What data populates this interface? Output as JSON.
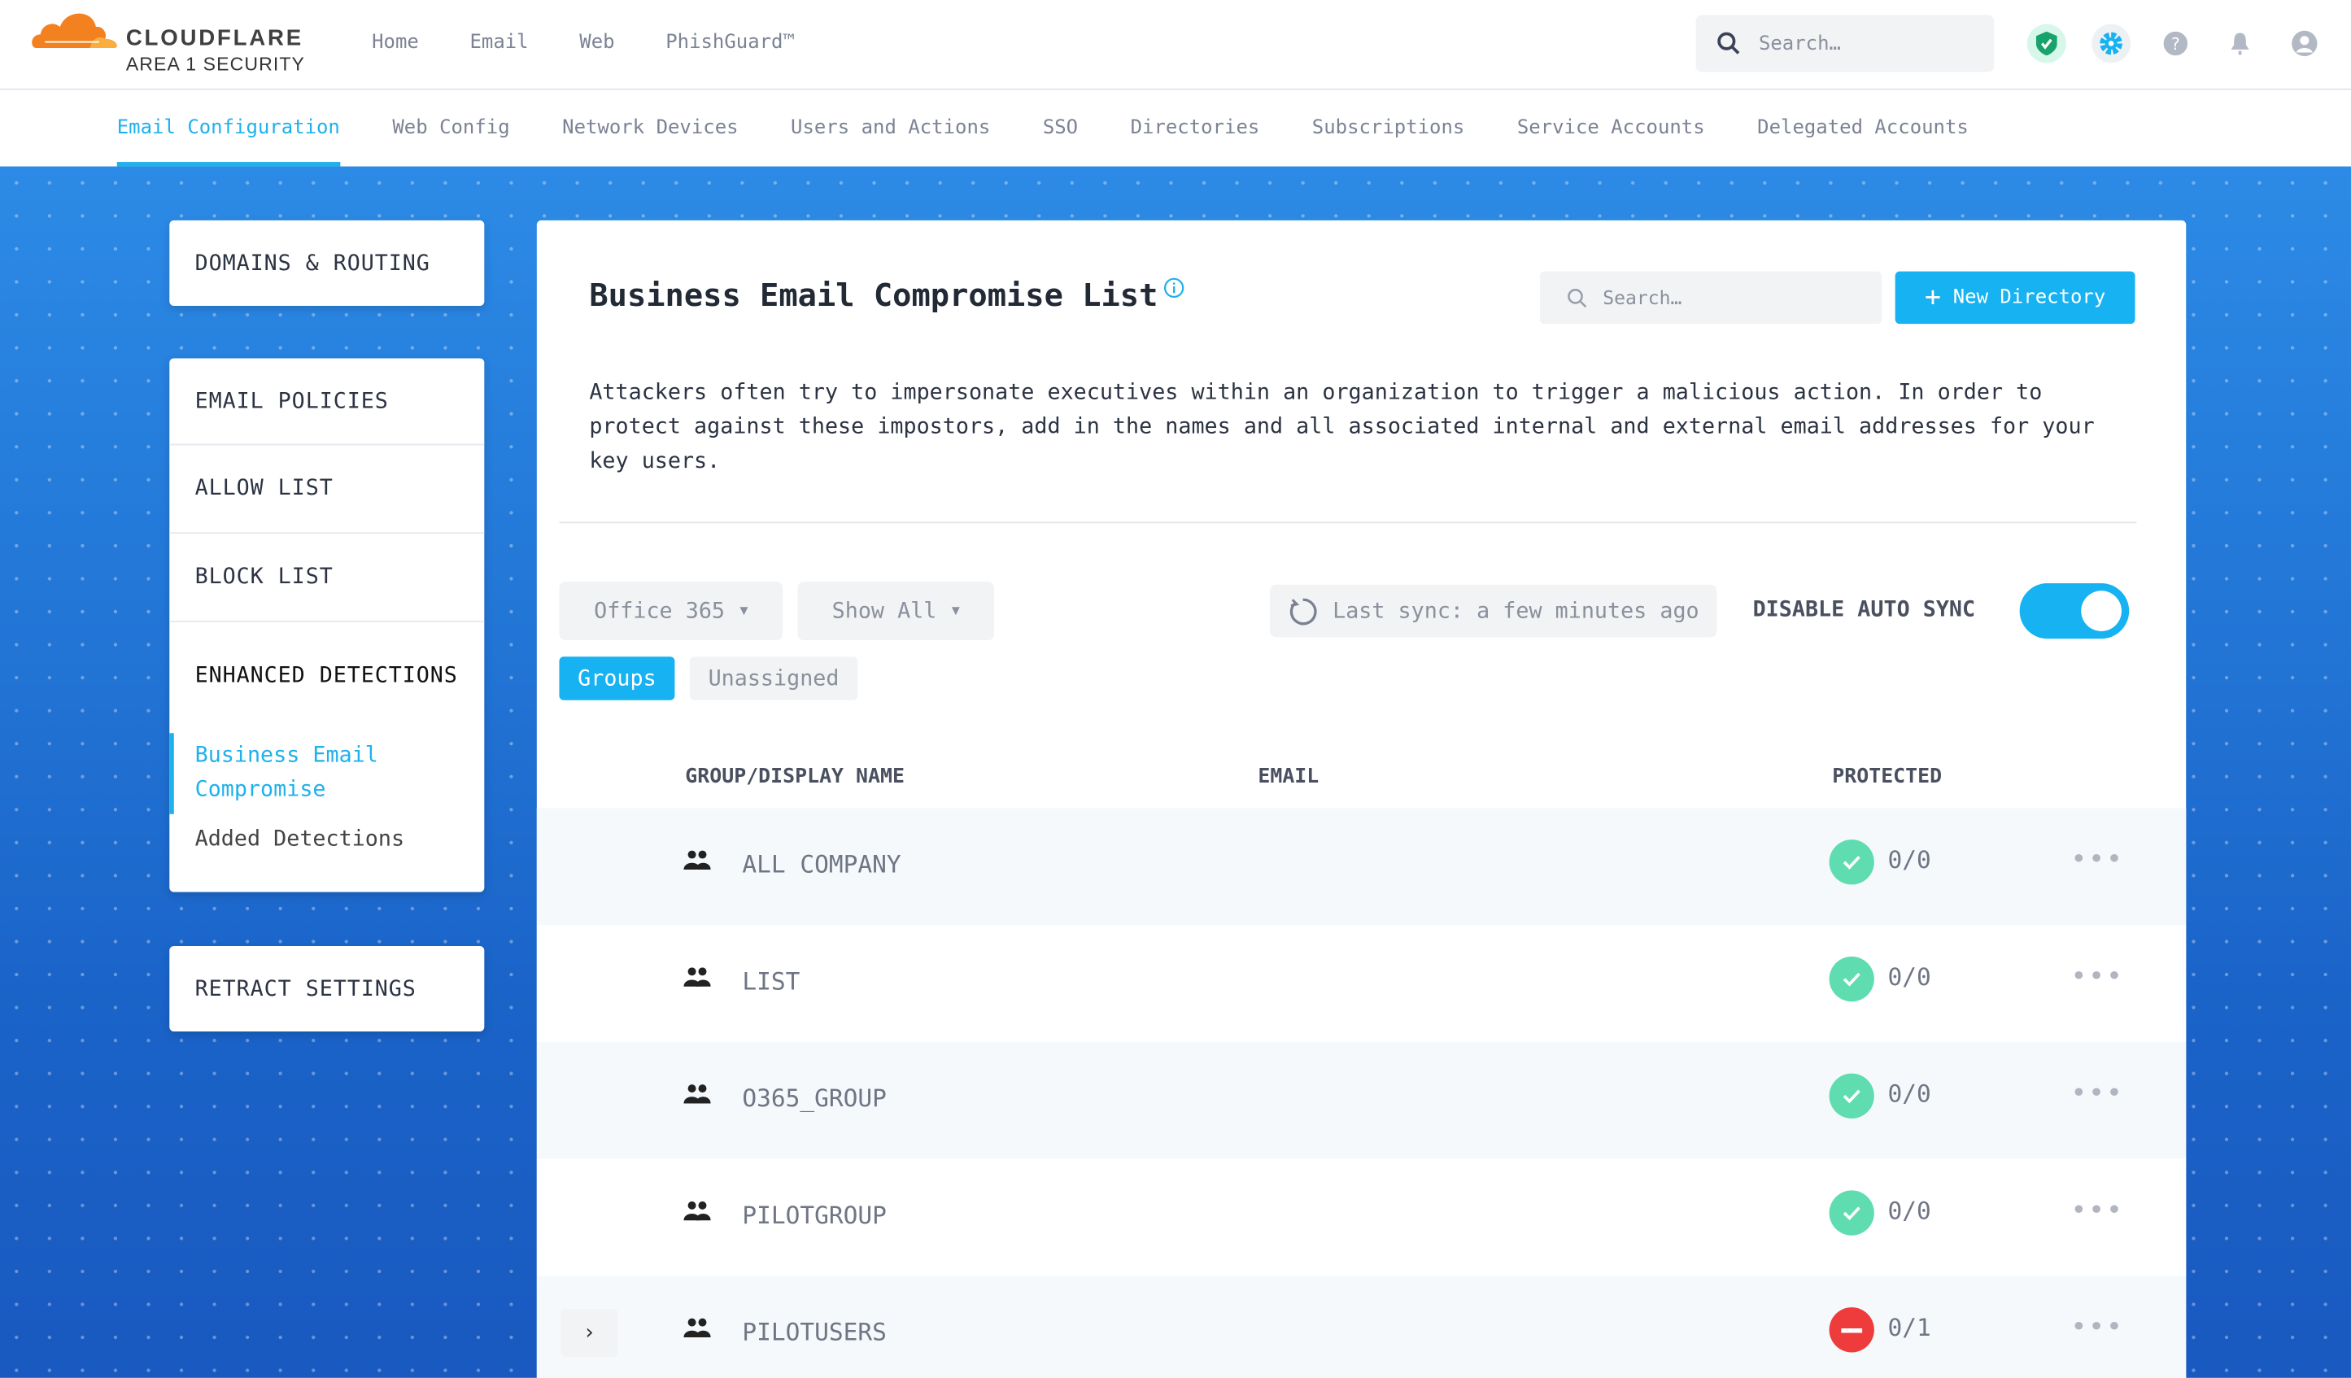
{
  "brand": {
    "name": "CLOUDFLARE",
    "sub": "AREA 1 SECURITY"
  },
  "topnav": [
    "Home",
    "Email",
    "Web",
    "PhishGuard™"
  ],
  "topsearch": {
    "placeholder": "Search…"
  },
  "topicons": [
    "shield-check-icon",
    "gear-icon",
    "help-icon",
    "bell-icon",
    "user-icon"
  ],
  "subnav": [
    "Email Configuration",
    "Web Config",
    "Network Devices",
    "Users and Actions",
    "SSO",
    "Directories",
    "Subscriptions",
    "Service Accounts",
    "Delegated Accounts"
  ],
  "sidebar": {
    "domains": "DOMAINS & ROUTING",
    "email_policies": "EMAIL POLICIES",
    "allow": "ALLOW LIST",
    "block": "BLOCK LIST",
    "enhanced": "ENHANCED DETECTIONS",
    "bec": "Business Email Compromise",
    "added": "Added Detections",
    "retract": "RETRACT SETTINGS"
  },
  "main": {
    "title": "Business Email Compromise List",
    "search_placeholder": "Search…",
    "new_button": "New Directory",
    "description": "Attackers often try to impersonate executives within an organization to trigger a malicious action. In order to protect against these impostors, add in the names and all associated internal and external email addresses for your key users.",
    "directory_select": "Office 365",
    "filter_select": "Show All",
    "last_sync": "Last sync: a few minutes ago",
    "auto_sync_label": "DISABLE AUTO SYNC",
    "auto_sync_on": true,
    "tabs": {
      "groups": "Groups",
      "unassigned": "Unassigned"
    },
    "columns": {
      "name": "GROUP/DISPLAY NAME",
      "email": "EMAIL",
      "protected": "PROTECTED"
    },
    "rows": [
      {
        "name": "ALL COMPANY",
        "protected": "0/0",
        "status": "ok"
      },
      {
        "name": "LIST",
        "protected": "0/0",
        "status": "ok"
      },
      {
        "name": "O365_GROUP",
        "protected": "0/0",
        "status": "ok"
      },
      {
        "name": "PILOTGROUP",
        "protected": "0/0",
        "status": "ok"
      },
      {
        "name": "PILOTUSERS",
        "protected": "0/1",
        "status": "blocked"
      }
    ]
  },
  "colors": {
    "accent": "#16b2f2",
    "ok": "#5fdcb0",
    "blocked": "#ee3b3b"
  }
}
